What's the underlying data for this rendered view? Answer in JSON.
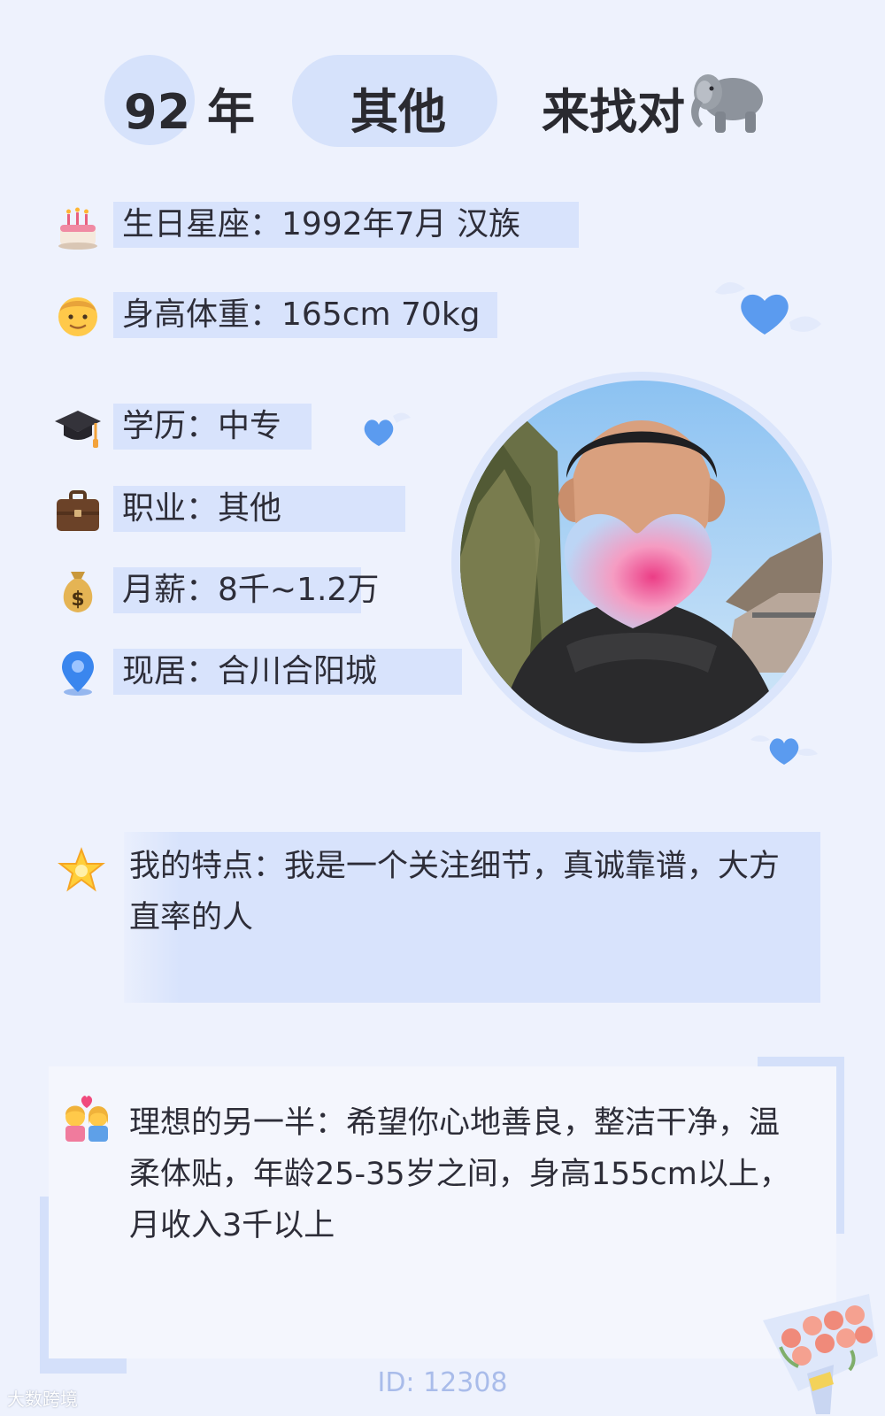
{
  "header": {
    "year": "92 年",
    "occupation_tag": "其他",
    "seeking": "来找对"
  },
  "info": {
    "birthday": "生日星座：1992年7月 汉族",
    "height_weight": "身高体重：165cm 70kg",
    "education": "学历：中专",
    "job": "职业：其他",
    "salary": "月薪：8千~1.2万",
    "residence": "现居：合川合阳城"
  },
  "features": "我的特点：我是一个关注细节，真诚靠谱，大方直率的人",
  "ideal_partner": "理想的另一半：希望你心地善良，整洁干净，温柔体贴，年龄25-35岁之间，身高155cm以上，月收入3千以上",
  "footer_id": "ID: 12308",
  "watermark": "大数跨境",
  "icons": {
    "birthday": "cake-icon",
    "height_weight": "person-icon",
    "education": "graduation-cap-icon",
    "job": "briefcase-icon",
    "salary": "money-bag-icon",
    "residence": "location-pin-icon",
    "features": "star-icon",
    "ideal_partner": "couple-heart-icon",
    "seeking": "elephant-icon"
  },
  "colors": {
    "background": "#eef2fd",
    "highlight": "#d8e3fc",
    "heart": "#5b9bef",
    "id_text": "#a9bcea"
  }
}
